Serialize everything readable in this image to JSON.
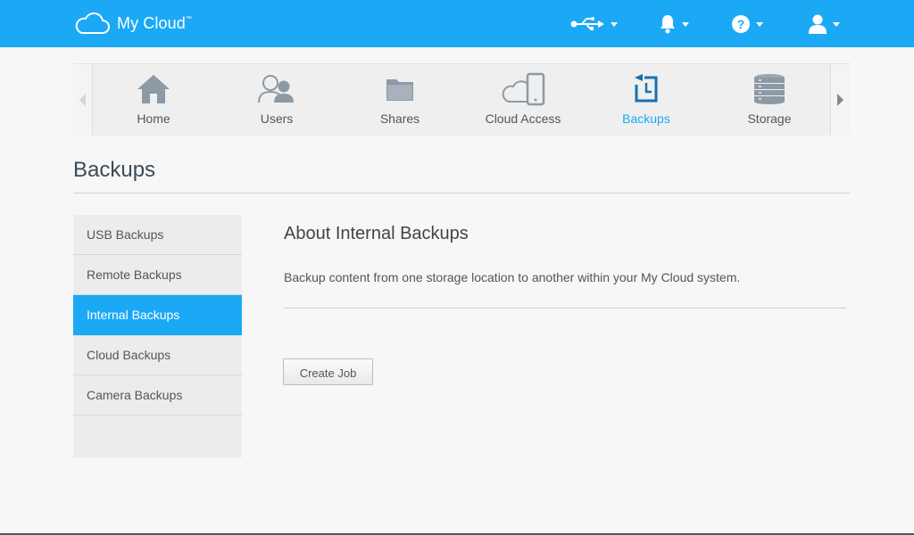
{
  "app": {
    "title": "My Cloud",
    "trademark": "™"
  },
  "colors": {
    "accent": "#1ba9f6",
    "icon_gray": "#8c9aa6"
  },
  "header": {
    "icons": [
      {
        "name": "usb-icon"
      },
      {
        "name": "bell-icon"
      },
      {
        "name": "help-icon"
      },
      {
        "name": "user-icon"
      }
    ]
  },
  "nav": {
    "items": [
      {
        "label": "Home",
        "icon": "home-icon"
      },
      {
        "label": "Users",
        "icon": "users-icon"
      },
      {
        "label": "Shares",
        "icon": "folder-icon"
      },
      {
        "label": "Cloud Access",
        "icon": "cloud-device-icon"
      },
      {
        "label": "Backups",
        "icon": "backup-icon",
        "active": true
      },
      {
        "label": "Storage",
        "icon": "storage-icon"
      }
    ]
  },
  "page": {
    "title": "Backups"
  },
  "sidebar": {
    "items": [
      {
        "label": "USB Backups"
      },
      {
        "label": "Remote Backups"
      },
      {
        "label": "Internal Backups",
        "active": true
      },
      {
        "label": "Cloud Backups"
      },
      {
        "label": "Camera Backups"
      }
    ]
  },
  "main": {
    "title": "About Internal Backups",
    "description": "Backup content from one storage location to another within your My Cloud system.",
    "button_label": "Create Job"
  }
}
